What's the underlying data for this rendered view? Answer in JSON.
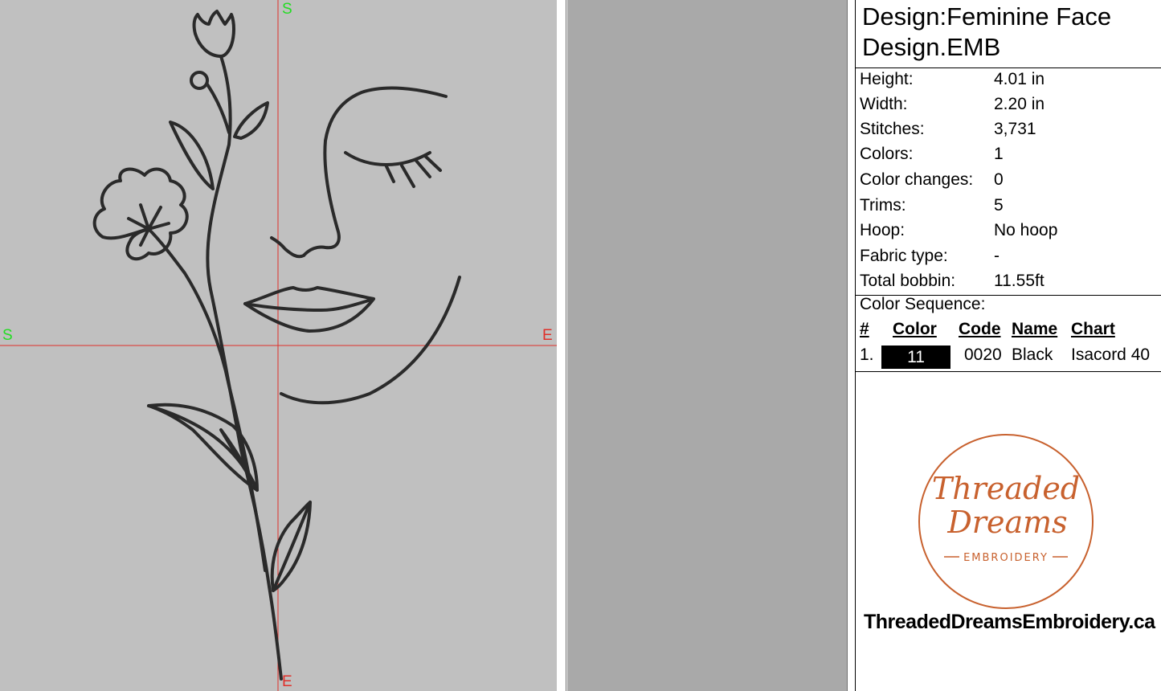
{
  "design": {
    "title_line1": "Design:Feminine Face",
    "title_line2": "Design.EMB"
  },
  "info": [
    {
      "key": "Height:",
      "value": "4.01 in"
    },
    {
      "key": "Width:",
      "value": "2.20 in"
    },
    {
      "key": "Stitches:",
      "value": "3,731"
    },
    {
      "key": "Colors:",
      "value": "1"
    },
    {
      "key": "Color changes:",
      "value": "0"
    },
    {
      "key": "Trims:",
      "value": "5"
    },
    {
      "key": "Hoop:",
      "value": "No hoop"
    },
    {
      "key": "Fabric type:",
      "value": "-"
    },
    {
      "key": "Total bobbin:",
      "value": "11.55ft"
    }
  ],
  "color_sequence": {
    "label": "Color Sequence:",
    "headers": {
      "num": "#",
      "color": "Color",
      "code": "Code",
      "name": "Name",
      "chart": "Chart"
    },
    "rows": [
      {
        "num": "1.",
        "color": "11",
        "code": "0020",
        "name": "Black",
        "chart": "Isacord 40",
        "swatch": "#000000"
      }
    ]
  },
  "axis": {
    "start": "S",
    "end": "E"
  },
  "logo": {
    "line1": "Threaded",
    "line2": "Dreams",
    "line3": "EMBROIDERY",
    "color": "#c8612e"
  },
  "website": "ThreadedDreamsEmbroidery.ca",
  "colors": {
    "canvas": "#c0c0c0",
    "strip": "#a9a9a9",
    "crosshair": "#e0302a",
    "start_marker": "#22dd22",
    "stitch": "#2a2a2a"
  }
}
